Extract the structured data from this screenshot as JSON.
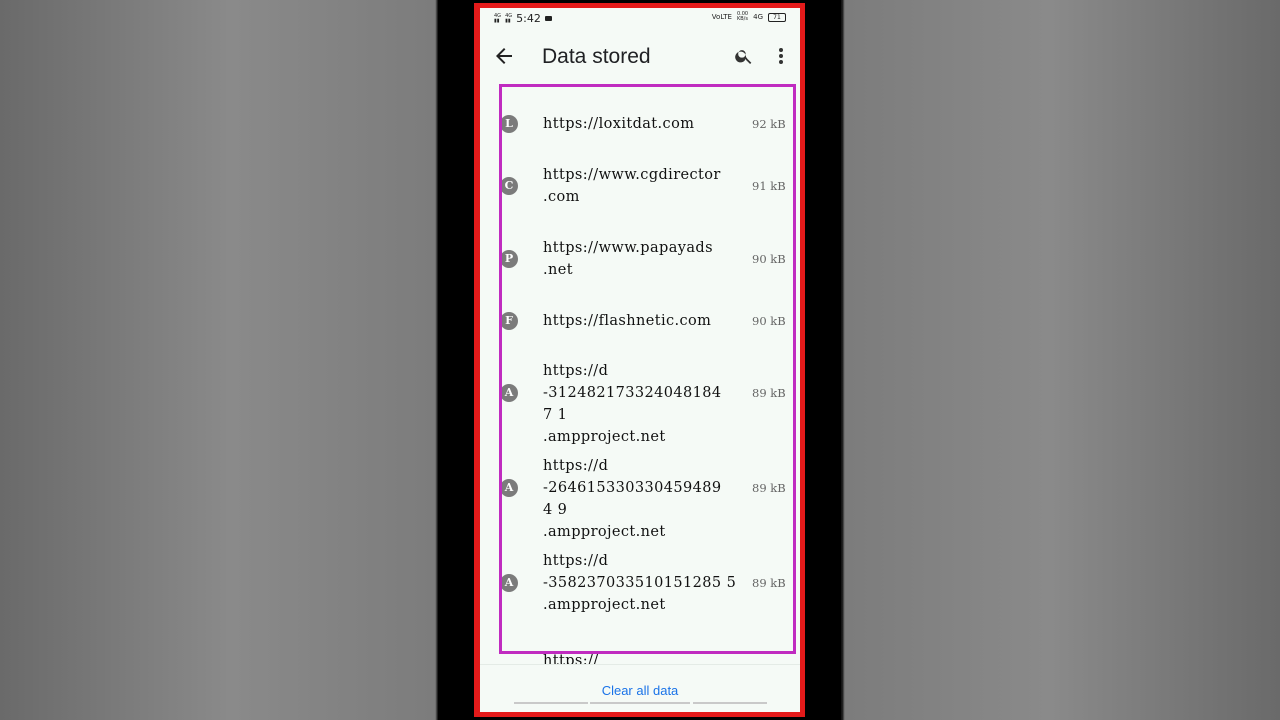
{
  "status_bar": {
    "left_sims": [
      "4G",
      "4G"
    ],
    "time": "5:42",
    "net_speed": "0.00",
    "net_unit": "KB/s",
    "volte": "VoLTE",
    "network": "4G",
    "battery": "71"
  },
  "app_bar": {
    "title": "Data stored",
    "back_icon": "arrow-left-icon",
    "search_icon": "search-icon",
    "more_icon": "more-vert-icon"
  },
  "sites": [
    {
      "letter": "L",
      "url": "https://loxitdat.com",
      "size": "92 kB"
    },
    {
      "letter": "C",
      "url": "https://www.cgdirector\n.com",
      "size": "91 kB"
    },
    {
      "letter": "P",
      "url": "https://www.papayads\n.net",
      "size": "90 kB"
    },
    {
      "letter": "F",
      "url": "https://flashnetic.com",
      "size": "90 kB"
    },
    {
      "letter": "A",
      "url": "https://d\n-3124821733240481847 1\n.ampproject.net",
      "size": "89 kB"
    },
    {
      "letter": "A",
      "url": "https://d\n-2646153303304594894 9\n.ampproject.net",
      "size": "89 kB"
    },
    {
      "letter": "A",
      "url": "https://d\n-358237033510151285 5\n.ampproject.net",
      "size": "89 kB"
    },
    {
      "letter": "",
      "url": "https://",
      "size": ""
    }
  ],
  "footer": {
    "clear_label": "Clear all data"
  },
  "colors": {
    "accent": "#1a73e8",
    "highlight_border": "#c02bc0",
    "frame_border": "#e41a1a"
  }
}
